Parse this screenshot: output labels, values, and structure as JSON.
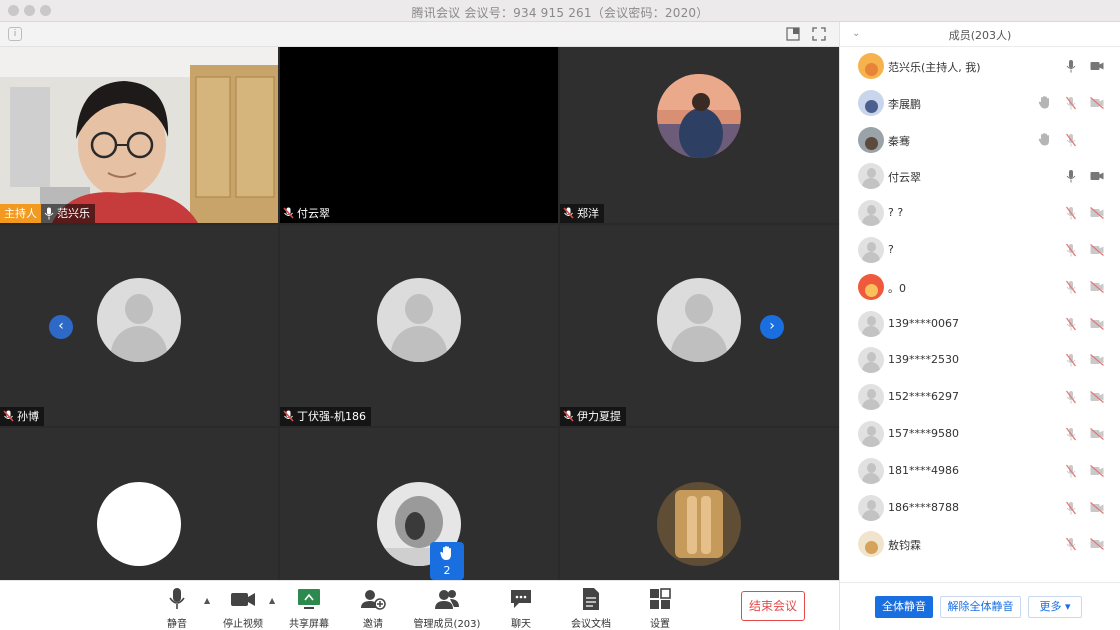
{
  "window": {
    "title": "腾讯会议 会议号：934 915 261（会议密码：2020）"
  },
  "tiles": [
    {
      "name": "范兴乐",
      "host_label": "主持人"
    },
    {
      "name": "付云翠"
    },
    {
      "name": "郑洋"
    },
    {
      "name": "孙博"
    },
    {
      "name": "丁伏强-机186"
    },
    {
      "name": "伊力夏提"
    }
  ],
  "hand_raise": {
    "count": "2"
  },
  "controls": {
    "mute": "静音",
    "stop_video": "停止视频",
    "share_screen": "共享屏幕",
    "invite": "邀请",
    "manage_members": "管理成员(203)",
    "chat": "聊天",
    "documents": "会议文档",
    "settings": "设置",
    "end_meeting": "结束会议"
  },
  "panel": {
    "title": "成员(203人)",
    "members": [
      {
        "name": "范兴乐(主持人, 我)",
        "mic": "on",
        "cam": "on",
        "avatar": "photo-orange"
      },
      {
        "name": "李展鹏",
        "mic": "muted",
        "cam": "muted",
        "hand": true,
        "avatar": "photo-blue"
      },
      {
        "name": "秦骞",
        "mic": "muted",
        "cam": "none",
        "hand": true,
        "avatar": "photo-gray"
      },
      {
        "name": "付云翠",
        "mic": "on",
        "cam": "on",
        "avatar": "default"
      },
      {
        "name": "? ?",
        "mic": "muted",
        "cam": "muted",
        "avatar": "default"
      },
      {
        "name": "?",
        "mic": "muted",
        "cam": "muted",
        "avatar": "default"
      },
      {
        "name": "。0",
        "mic": "muted",
        "cam": "muted",
        "avatar": "photo-red"
      },
      {
        "name": "139****0067",
        "mic": "muted",
        "cam": "muted",
        "avatar": "default"
      },
      {
        "name": "139****2530",
        "mic": "muted",
        "cam": "muted",
        "avatar": "default"
      },
      {
        "name": "152****6297",
        "mic": "muted",
        "cam": "muted",
        "avatar": "default"
      },
      {
        "name": "157****9580",
        "mic": "muted",
        "cam": "muted",
        "avatar": "default"
      },
      {
        "name": "181****4986",
        "mic": "muted",
        "cam": "muted",
        "avatar": "default"
      },
      {
        "name": "186****8788",
        "mic": "muted",
        "cam": "muted",
        "avatar": "default"
      },
      {
        "name": "敖钧霖",
        "mic": "muted",
        "cam": "muted",
        "avatar": "photo-cartoon"
      }
    ],
    "mute_all": "全体静音",
    "unmute_all": "解除全体静音",
    "more": "更多"
  },
  "colors": {
    "accent": "#1a6fe0",
    "host_badge": "#f29a1f",
    "end_red": "#e34b4b"
  }
}
